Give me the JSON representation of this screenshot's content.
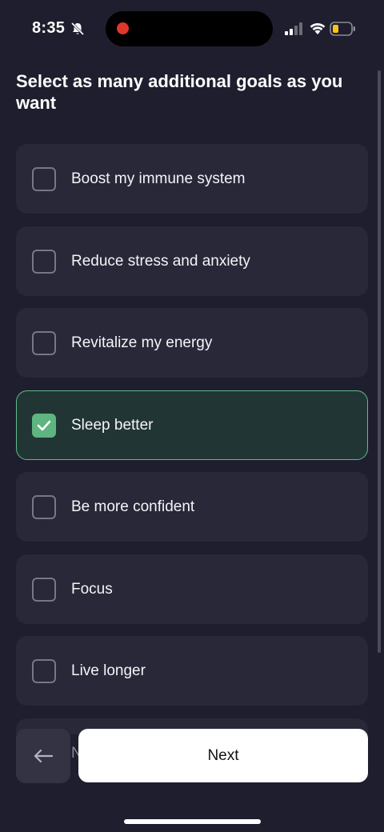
{
  "status": {
    "time": "8:35",
    "icons": [
      "bell-slash-icon",
      "signal-icon",
      "wifi-icon",
      "battery-low-icon"
    ]
  },
  "heading": "Select as many additional goals as you want",
  "options": [
    {
      "label": "Boost my immune system",
      "checked": false
    },
    {
      "label": "Reduce stress and anxiety",
      "checked": false
    },
    {
      "label": "Revitalize my energy",
      "checked": false
    },
    {
      "label": "Sleep better",
      "checked": true
    },
    {
      "label": "Be more confident",
      "checked": false
    },
    {
      "label": "Focus",
      "checked": false
    },
    {
      "label": "Live longer",
      "checked": false
    }
  ],
  "peek_text": "N",
  "buttons": {
    "next_label": "Next",
    "back_icon": "arrow-left-icon"
  },
  "colors": {
    "background": "#1f1e2e",
    "card": "#282839",
    "selected_card": "#213534",
    "accent": "#5eb580",
    "primary_button": "#ffffff"
  }
}
